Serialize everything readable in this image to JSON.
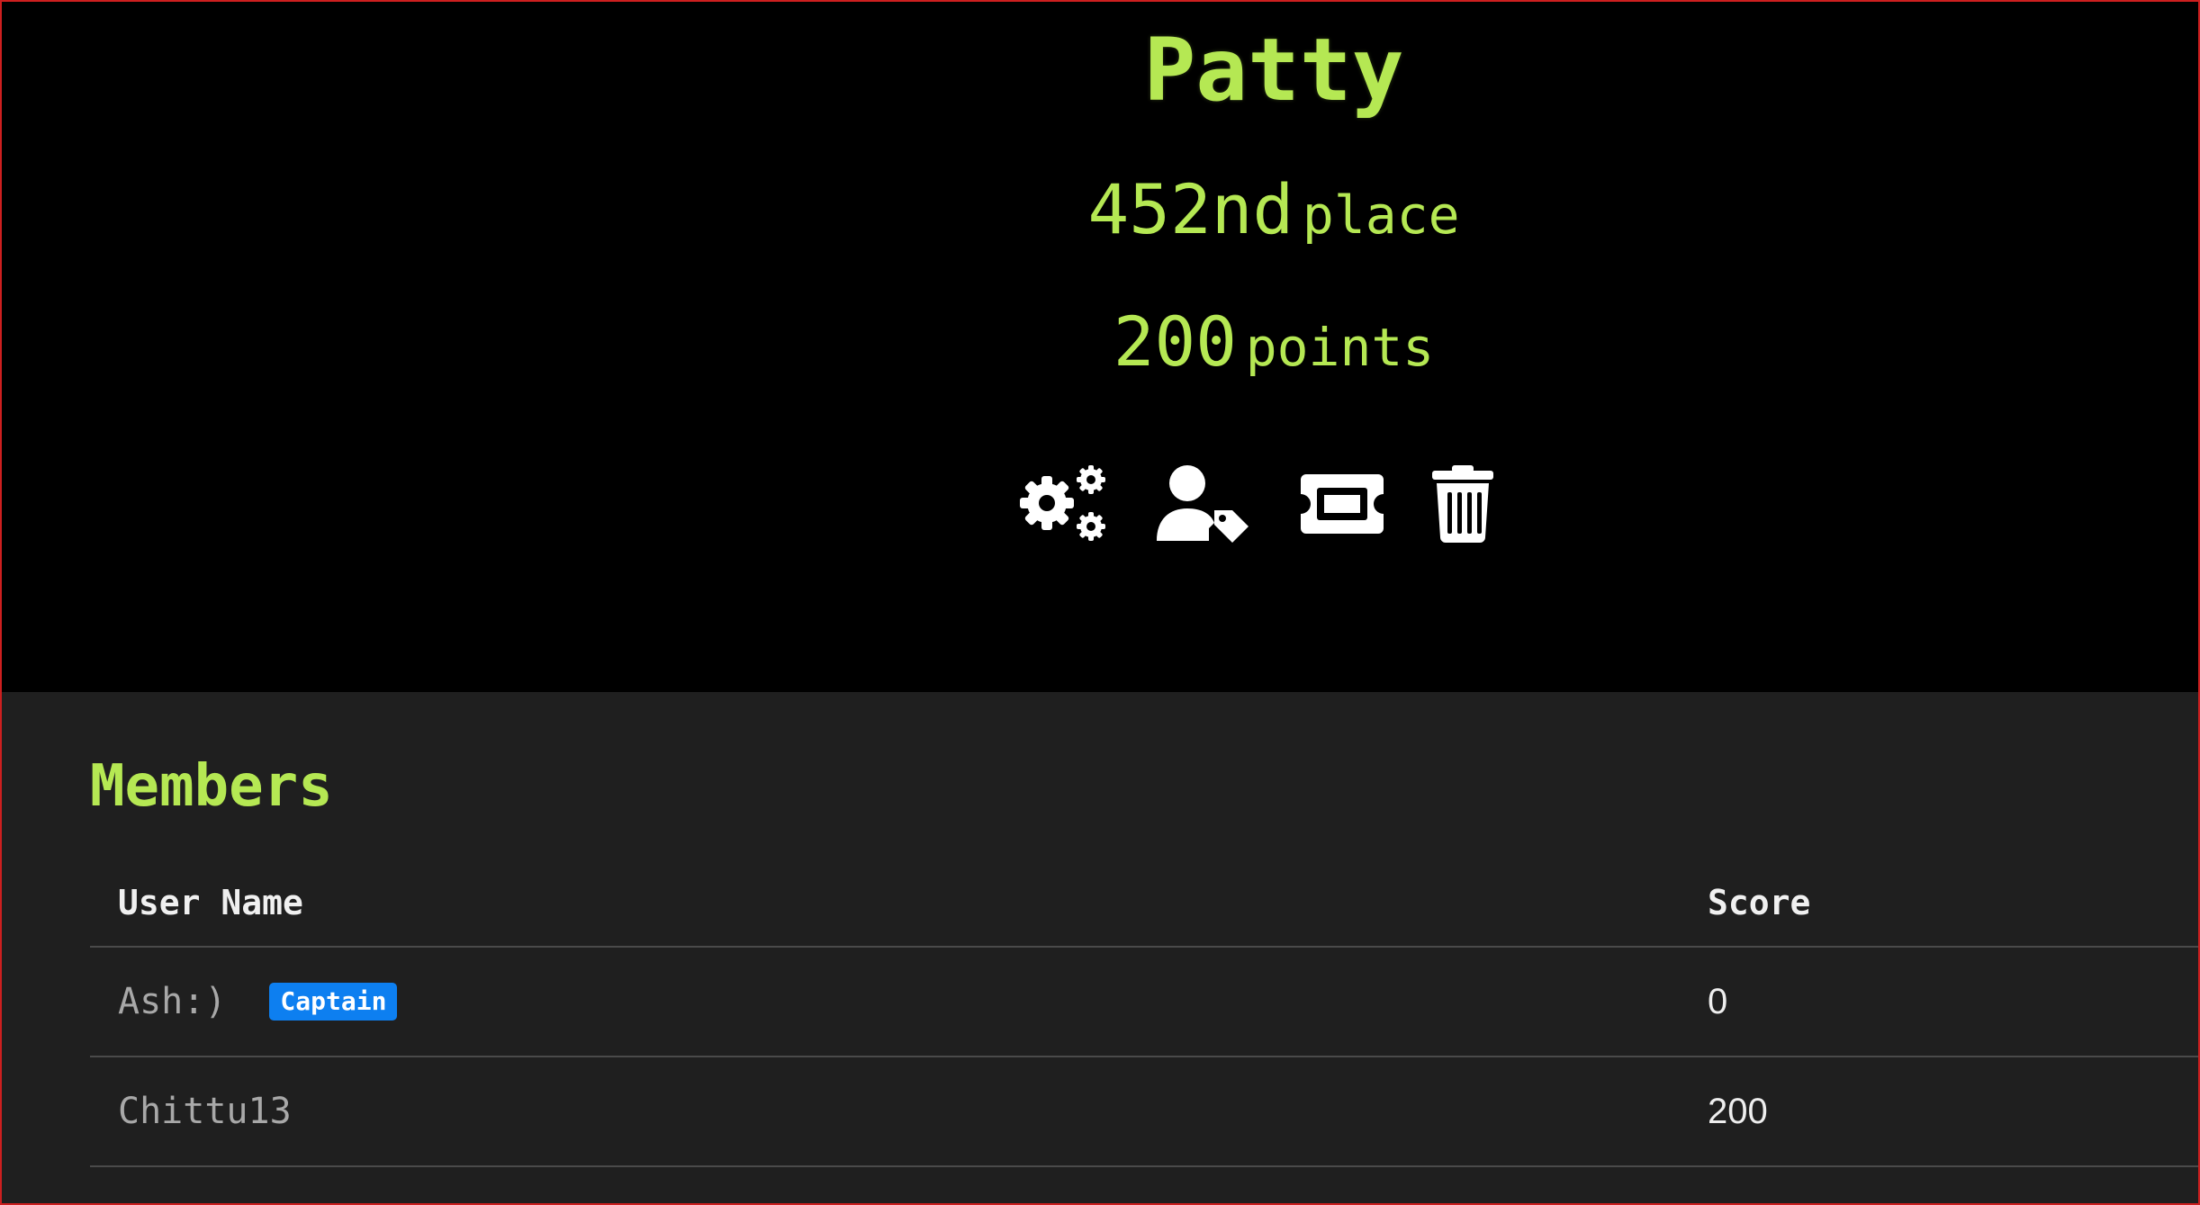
{
  "team": {
    "name": "Patty",
    "place_number": "452nd",
    "place_word": "place",
    "points_number": "200",
    "points_word": "points"
  },
  "actions": [
    {
      "icon": "gears-icon",
      "label": "settings"
    },
    {
      "icon": "user-tag-icon",
      "label": "captain"
    },
    {
      "icon": "ticket-icon",
      "label": "invite"
    },
    {
      "icon": "trash-icon",
      "label": "disband"
    }
  ],
  "members": {
    "title": "Members",
    "columns": [
      "User Name",
      "Score"
    ],
    "rows": [
      {
        "name": "Ash:)",
        "badge": "Captain",
        "score": "0"
      },
      {
        "name": "Chittu13",
        "badge": "",
        "score": "200"
      }
    ]
  },
  "colors": {
    "accent": "#b5e853",
    "badge": "#0d7ff0",
    "background": "#000000",
    "panel": "#1f1f1f"
  }
}
